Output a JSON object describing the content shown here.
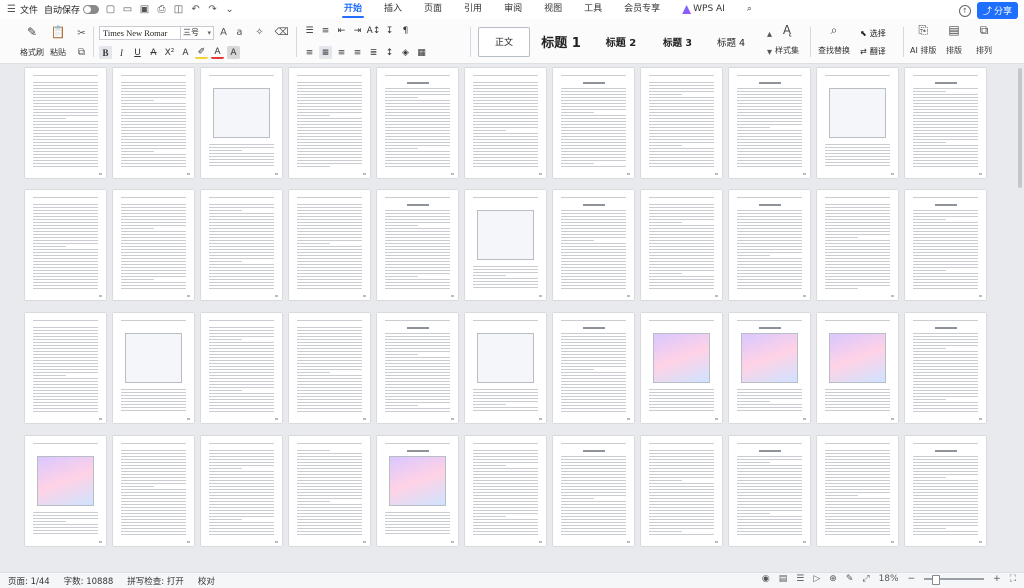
{
  "topbar": {
    "file_label": "文件",
    "autosave_label": "自动保存",
    "tabs": [
      {
        "label": "开始",
        "active": true
      },
      {
        "label": "插入",
        "active": false
      },
      {
        "label": "页面",
        "active": false
      },
      {
        "label": "引用",
        "active": false
      },
      {
        "label": "审阅",
        "active": false
      },
      {
        "label": "视图",
        "active": false
      },
      {
        "label": "工具",
        "active": false
      },
      {
        "label": "会员专享",
        "active": false
      }
    ],
    "wps_ai_label": "WPS AI",
    "share_label": "分享"
  },
  "ribbon": {
    "format_painter_label": "格式刷",
    "paste_label": "粘贴",
    "font_name": "Times New Romar",
    "font_size": "三号",
    "styles": {
      "normal": "正文",
      "h1": "标题 1",
      "h2": "标题 2",
      "h3": "标题 3",
      "h4": "标题 4"
    },
    "style_set_label": "样式集",
    "find_replace_label": "查找替换",
    "select_label": "选择",
    "translate_label": "翻译",
    "ai_layout_label": "AI 排版",
    "layout_label": "排版",
    "arrange_label": "排列"
  },
  "status": {
    "page": "页面: 1/44",
    "word_count": "字数: 10888",
    "spell_check": "拼写检查: 打开",
    "proofread": "校对",
    "zoom": "18%"
  },
  "colors": {
    "accent": "#1f6fff",
    "canvas": "#e8eaed"
  }
}
